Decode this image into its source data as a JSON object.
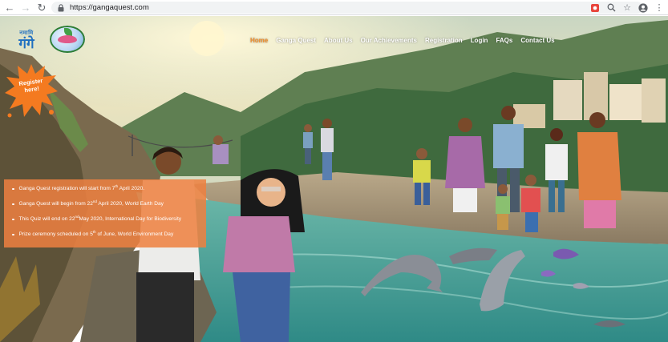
{
  "browser": {
    "url": "https://gangaquest.com",
    "icons": {
      "back": "back-arrow-icon",
      "forward": "forward-arrow-icon",
      "reload": "reload-icon",
      "lock": "lock-icon",
      "extension": "extension-icon",
      "zoom": "zoom-icon",
      "bookmark": "star-icon",
      "profile": "profile-icon",
      "menu": "kebab-menu-icon"
    }
  },
  "site": {
    "nav": [
      {
        "label": "Home",
        "active": true
      },
      {
        "label": "Ganga Quest",
        "active": false
      },
      {
        "label": "About Us",
        "active": false
      },
      {
        "label": "Our Achievements",
        "active": false
      },
      {
        "label": "Registration",
        "active": false
      },
      {
        "label": "Login",
        "active": false
      },
      {
        "label": "FAQs",
        "active": false
      },
      {
        "label": "Contact Us",
        "active": false
      }
    ],
    "logo_namami": {
      "top": "नमामि",
      "bottom": "गंगे"
    },
    "register": {
      "line1": "Register",
      "line2": "here!"
    },
    "announcements": [
      {
        "before": "Ganga Quest registration will start from 7",
        "sup": "th",
        "after": " April 2020."
      },
      {
        "before": "Ganga Quest will begin from 22",
        "sup": "nd",
        "after": " April 2020, World Earth Day"
      },
      {
        "before": "This Quiz will end on 22",
        "sup": "nd",
        "after": "May 2020, International Day for Biodiversity"
      },
      {
        "before": "Prize ceremony scheduled on 5",
        "sup": "th",
        "after": " of June, World Environment Day"
      }
    ]
  },
  "colors": {
    "accent_orange": "#f28c28",
    "info_box": "#ee8040",
    "river": "#4fa89a"
  }
}
